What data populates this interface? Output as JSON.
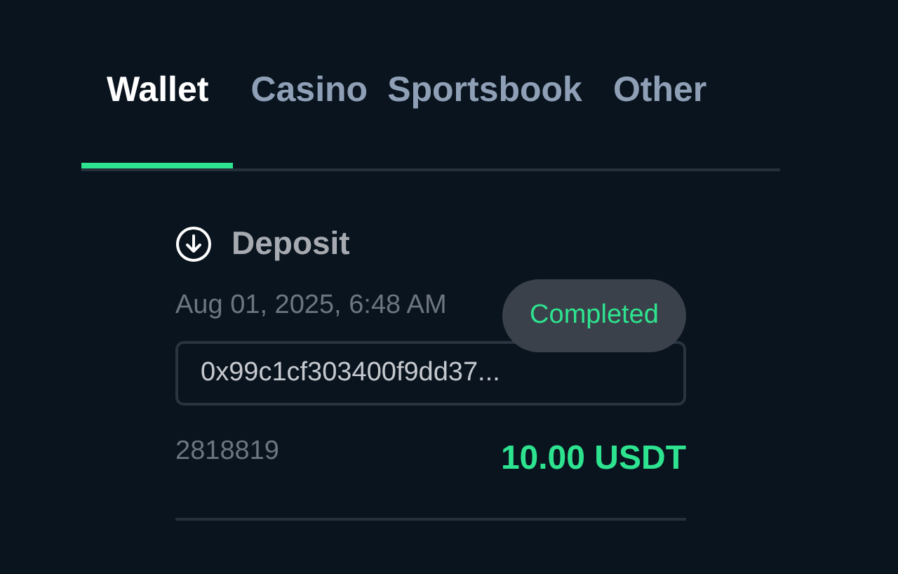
{
  "tabs": [
    {
      "label": "Wallet",
      "selected": true
    },
    {
      "label": "Casino",
      "selected": false
    },
    {
      "label": "Sportsbook",
      "selected": false
    },
    {
      "label": "Other",
      "selected": false
    }
  ],
  "transaction": {
    "type": "Deposit",
    "date": "Aug 01, 2025, 6:48 AM",
    "status": "Completed",
    "hash": "0x99c1cf303400f9dd37...",
    "id": "2818819",
    "amount": "10.00 USDT"
  }
}
